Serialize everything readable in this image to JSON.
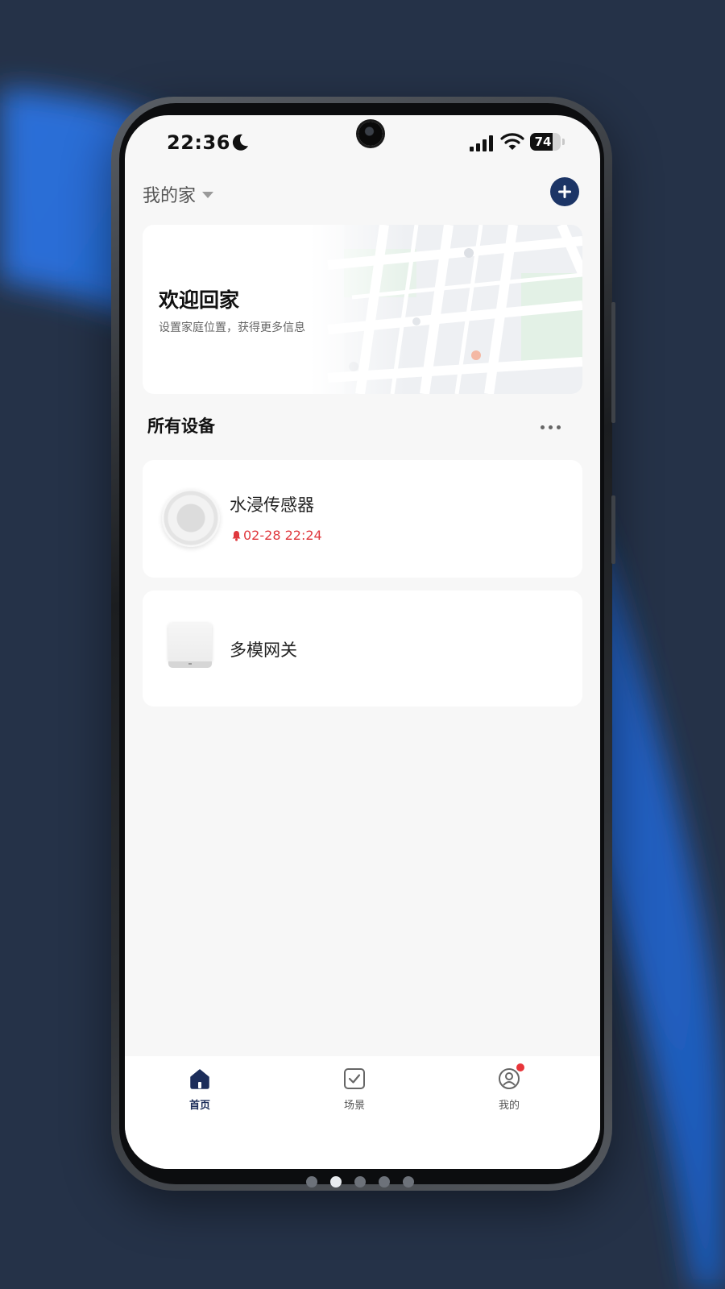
{
  "status_bar": {
    "time": "22:36",
    "battery": "74",
    "battery_level_percent": 74,
    "icons": [
      "moon-icon",
      "signal-icon",
      "wifi-icon",
      "battery-icon"
    ]
  },
  "header": {
    "home_name": "我的家",
    "add_button_icon": "plus-icon"
  },
  "welcome_card": {
    "title": "欢迎回家",
    "subtitle": "设置家庭位置，获得更多信息"
  },
  "devices_section": {
    "title": "所有设备",
    "more_icon": "more-icon"
  },
  "devices": [
    {
      "name": "水浸传感器",
      "alert_time": "02-28 22:24",
      "icon": "water-sensor-icon",
      "alert_icon": "bell-icon"
    },
    {
      "name": "多模网关",
      "icon": "gateway-icon"
    }
  ],
  "tab_bar": {
    "tabs": [
      {
        "label": "首页",
        "icon": "home-icon",
        "active": true
      },
      {
        "label": "场景",
        "icon": "scene-check-icon",
        "active": false
      },
      {
        "label": "我的",
        "icon": "profile-icon",
        "active": false,
        "has_badge": true
      }
    ]
  },
  "pager": {
    "count": 5,
    "active_index": 1
  },
  "colors": {
    "background": "#253248",
    "accent_blue": "#2a6fd8",
    "primary_navy": "#1c3566",
    "alert_red": "#e0393e",
    "screen_bg": "#f7f7f7"
  }
}
